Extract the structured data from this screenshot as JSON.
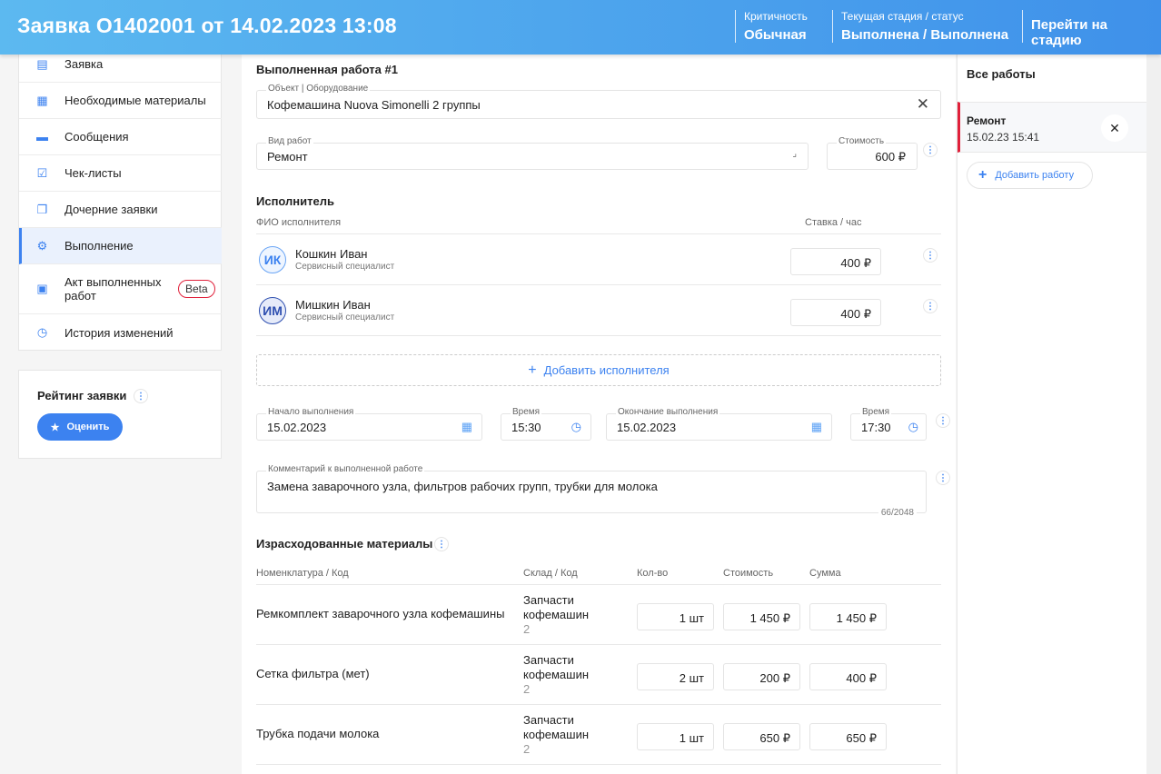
{
  "header": {
    "title": "Заявка О1402001 от 14.02.2023 13:08",
    "criticality_label": "Критичность",
    "criticality_value": "Обычная",
    "stage_label": "Текущая стадия / статус",
    "stage_value": "Выполнена / Выполнена",
    "goto_stage": "Перейти на стадию"
  },
  "nav": {
    "items": [
      {
        "label": "Заявка",
        "icon": "clipboard-icon"
      },
      {
        "label": "Необходимые материалы",
        "icon": "boxes-icon"
      },
      {
        "label": "Сообщения",
        "icon": "message-icon"
      },
      {
        "label": "Чек-листы",
        "icon": "checklist-icon"
      },
      {
        "label": "Дочерние заявки",
        "icon": "copy-icon"
      },
      {
        "label": "Выполнение",
        "icon": "gear-icon"
      },
      {
        "label": "Акт выполненных работ",
        "icon": "act-icon",
        "badge": "Beta"
      },
      {
        "label": "История изменений",
        "icon": "history-icon"
      }
    ]
  },
  "rating": {
    "title": "Рейтинг заявки",
    "button": "Оценить"
  },
  "work": {
    "title": "Выполненная работа #1",
    "object_label": "Объект | Оборудование",
    "object_value": "Кофемашина Nuova Simonelli 2 группы",
    "type_label": "Вид работ",
    "type_value": "Ремонт",
    "cost_label": "Стоимость",
    "cost_value": "600 ₽"
  },
  "executors": {
    "title": "Исполнитель",
    "col_name": "ФИО исполнителя",
    "col_rate": "Ставка / час",
    "rows": [
      {
        "initials": "ИК",
        "name": "Кошкин Иван",
        "role": "Сервисный специалист",
        "rate": "400 ₽"
      },
      {
        "initials": "ИМ",
        "name": "Мишкин Иван",
        "role": "Сервисный специалист",
        "rate": "400 ₽"
      }
    ],
    "add": "Добавить исполнителя"
  },
  "dates": {
    "start_label": "Начало выполнения",
    "start_value": "15.02.2023",
    "time1_label": "Время",
    "time1_value": "15:30",
    "end_label": "Окончание выполнения",
    "end_value": "15.02.2023",
    "time2_label": "Время",
    "time2_value": "17:30"
  },
  "comment": {
    "label": "Комментарий к выполненной работе",
    "value": "Замена заварочного узла, фильтров рабочих групп, трубки для молока",
    "counter": "66/2048"
  },
  "materials": {
    "title": "Израсходованные материалы",
    "cols": [
      "Номенклатура / Код",
      "Склад / Код",
      "Кол-во",
      "Стоимость",
      "Сумма"
    ],
    "rows": [
      {
        "name": "Ремкомплект заварочного узла кофемашины",
        "store1": "Запчасти",
        "store2": "кофемашин",
        "code": "2",
        "qty": "1 шт",
        "price": "1 450 ₽",
        "sum": "1 450 ₽"
      },
      {
        "name": "Сетка фильтра (мет)",
        "store1": "Запчасти",
        "store2": "кофемашин",
        "code": "2",
        "qty": "2 шт",
        "price": "200 ₽",
        "sum": "400 ₽"
      },
      {
        "name": "Трубка подачи молока",
        "store1": "Запчасти",
        "store2": "кофемашин",
        "code": "2",
        "qty": "1 шт",
        "price": "650 ₽",
        "sum": "650 ₽"
      }
    ]
  },
  "side": {
    "title": "Все работы",
    "work_name": "Ремонт",
    "work_date": "15.02.23 15:41",
    "add": "Добавить работу"
  },
  "colors": {
    "accent": "#3c82f0",
    "active_marker": "#e0203a"
  }
}
